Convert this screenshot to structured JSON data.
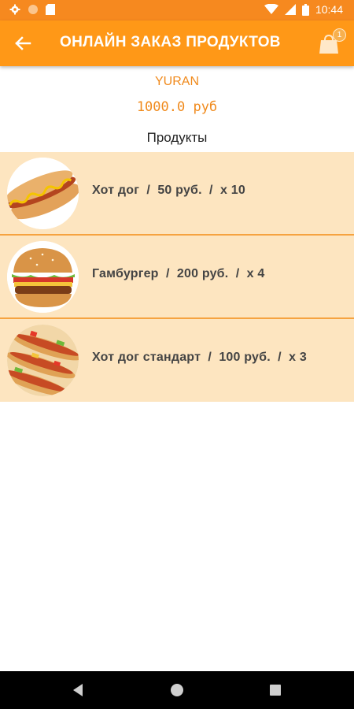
{
  "status_bar": {
    "time": "10:44",
    "left_icons": [
      "gear-icon",
      "circle-icon",
      "sd-card-icon"
    ],
    "right_icons": [
      "wifi-icon",
      "signal-icon",
      "battery-icon"
    ]
  },
  "app_bar": {
    "title": "ОНЛАЙН ЗАКАЗ ПРОДУКТОВ",
    "back_icon": "arrow-back-icon",
    "cart_icon": "shopping-bag-icon",
    "cart_badge": "1"
  },
  "user": {
    "name": "YURAN",
    "balance": "1000.0 руб"
  },
  "section_title": "Продукты",
  "products": [
    {
      "text": "Хот дог  /  50 руб.  /  x 10",
      "image": "hot-dog-image"
    },
    {
      "text": "Гамбургер  /  200 руб.  /  x 4",
      "image": "hamburger-image"
    },
    {
      "text": "Хот дог стандарт  /  100 руб.  /  x 3",
      "image": "hot-dog-standard-image"
    }
  ],
  "colors": {
    "status_bar": "#f6891f",
    "app_bar": "#ff9817",
    "accent_text": "#f08a1c",
    "row_background": "#fde5c0",
    "row_divider": "#f6a340"
  },
  "nav_bar": {
    "buttons": [
      "back-triangle-icon",
      "home-circle-icon",
      "recents-square-icon"
    ]
  }
}
